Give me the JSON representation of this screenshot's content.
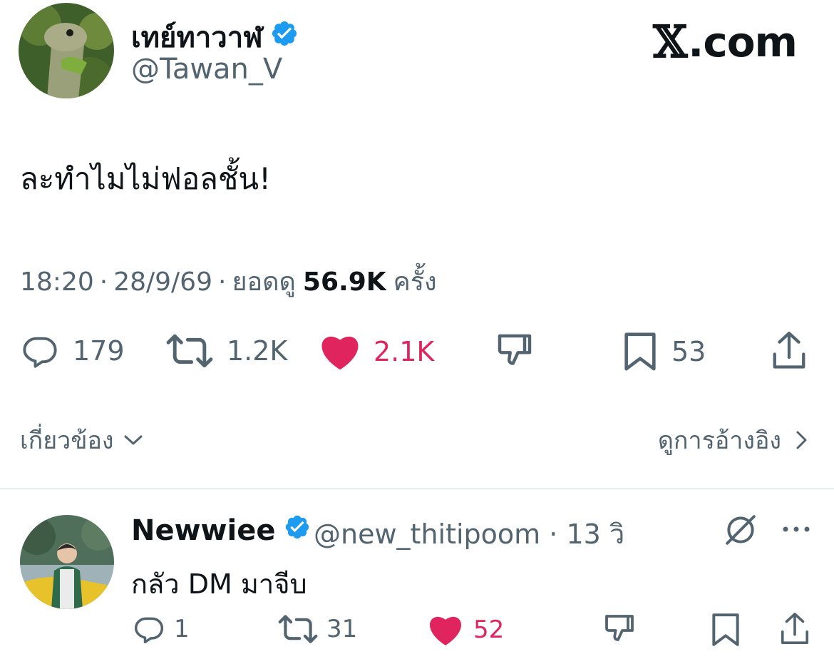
{
  "brand": {
    "x_symbol": "𝕏",
    "label": ".com"
  },
  "tweet": {
    "author_name": "เทย์ทาวาฬ",
    "author_handle": "@Tawan_V",
    "text": "ละทำไมไม่ฟอลชั้น!",
    "time": "18:20",
    "date": "28/9/69",
    "views_label": "ยอดดู",
    "views_count": "56.9K",
    "views_suffix": "ครั้ง",
    "separator": "·",
    "replies": "179",
    "retweets": "1.2K",
    "likes": "2.1K",
    "bookmarks": "53"
  },
  "links": {
    "related": "เกี่ยวข้อง",
    "quotes": "ดูการอ้างอิง"
  },
  "reply": {
    "author_name": "Newwiee",
    "author_handle": "@new_thitipoom",
    "separator": "·",
    "time_ago": "13 วิ",
    "text": "กลัว DM มาจีบ",
    "replies": "1",
    "retweets": "31",
    "likes": "52"
  },
  "colors": {
    "text": "#0f1419",
    "muted": "#536471",
    "verified": "#1d9bf0",
    "like": "#e0245e",
    "divider": "#cfd9de"
  }
}
